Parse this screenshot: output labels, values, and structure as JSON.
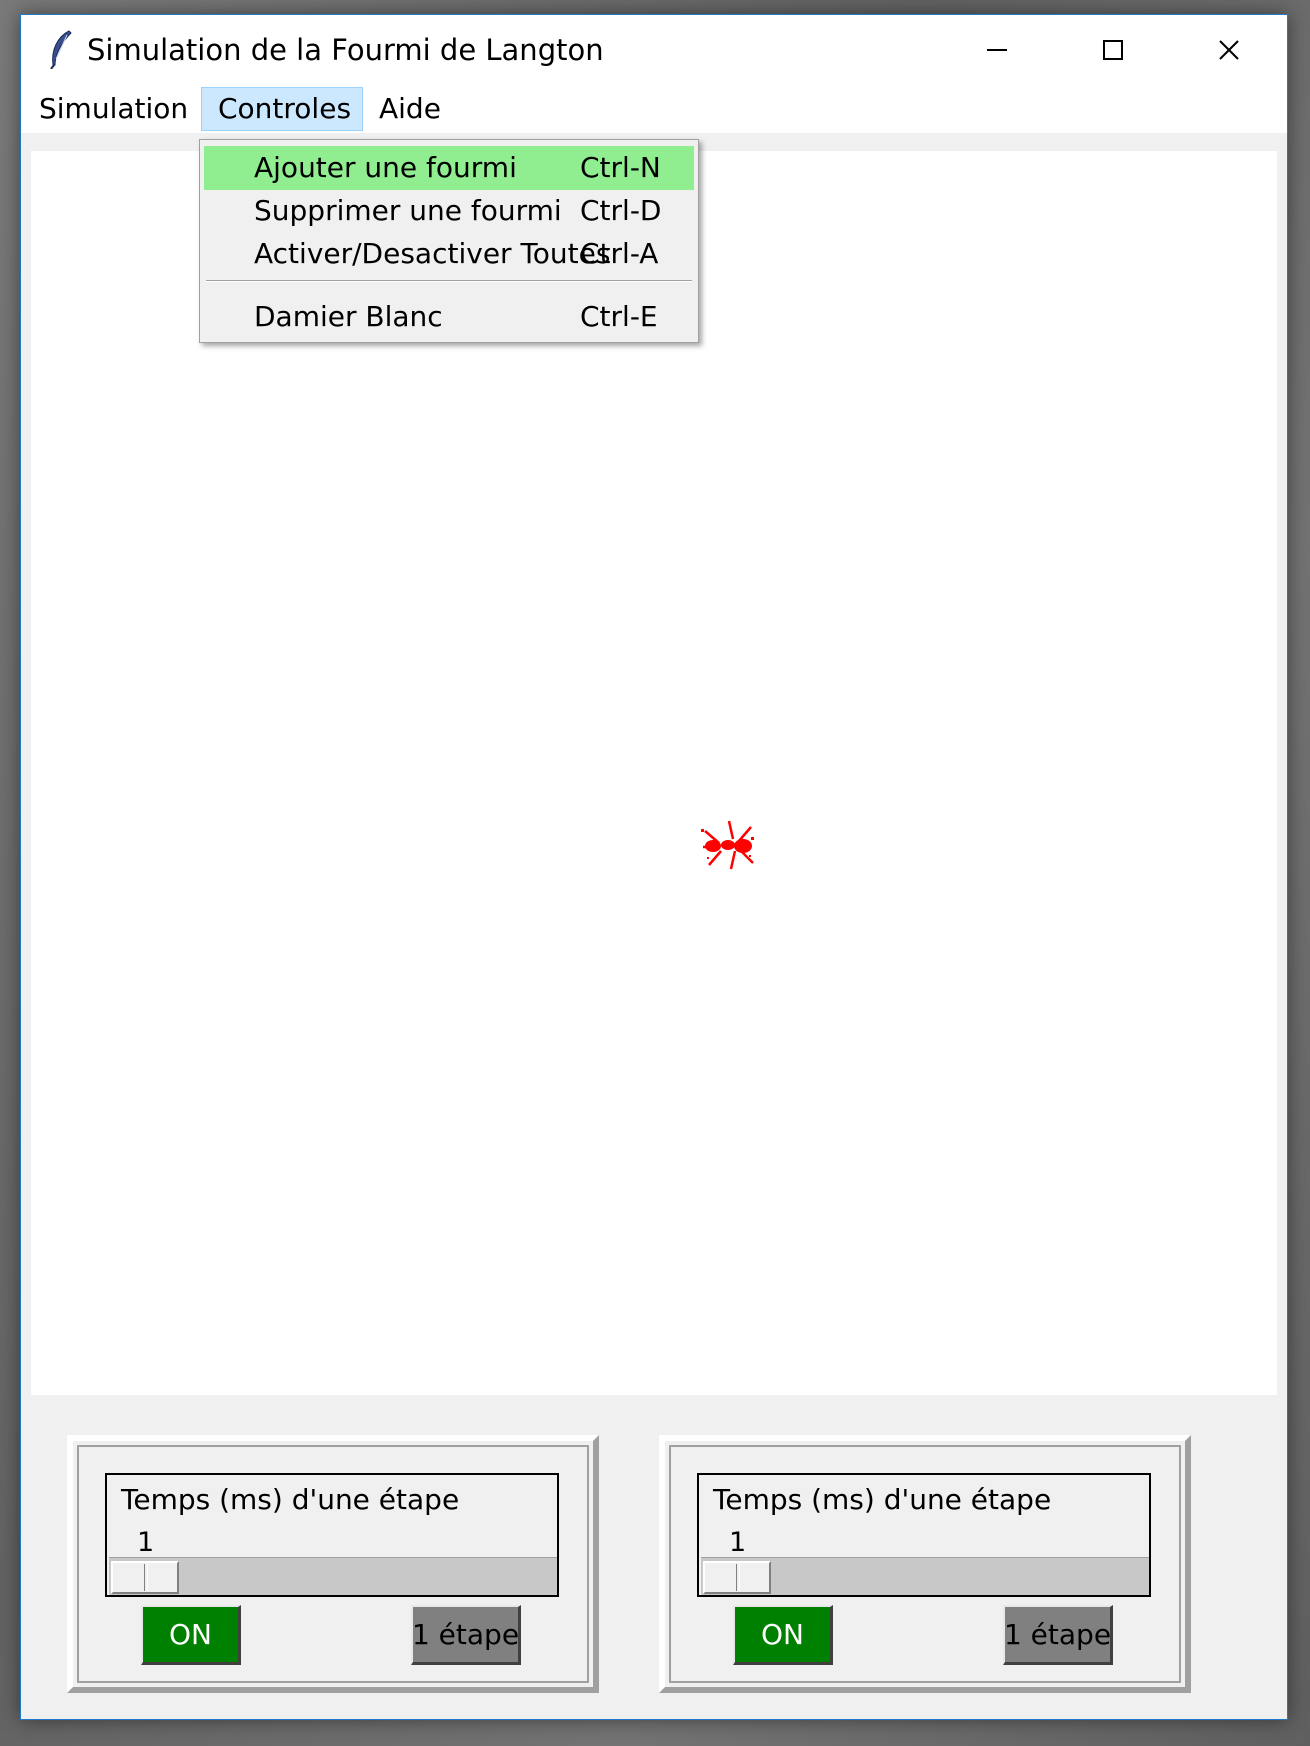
{
  "window": {
    "title": "Simulation de la Fourmi de Langton"
  },
  "menubar": {
    "items": [
      "Simulation",
      "Controles",
      "Aide"
    ],
    "open_menu": "Controles"
  },
  "dropdown": {
    "items": [
      {
        "label": "Ajouter une fourmi",
        "accel": "Ctrl-N",
        "highlighted": true
      },
      {
        "label": "Supprimer une fourmi",
        "accel": "Ctrl-D"
      },
      {
        "label": "Activer/Desactiver Toutes",
        "accel": "Ctrl-A"
      },
      {
        "label": "Damier Blanc",
        "accel": "Ctrl-E"
      }
    ],
    "highlight_color": "#90ee90"
  },
  "canvas": {
    "background": "#ffffff",
    "ant_color": "#ff0000",
    "ant_icon": "ant-icon"
  },
  "controls": [
    {
      "scale_label": "Temps (ms) d'une étape",
      "scale_value": "1",
      "on_label": "ON",
      "step_label": "1 étape"
    },
    {
      "scale_label": "Temps (ms) d'une étape",
      "scale_value": "1",
      "on_label": "ON",
      "step_label": "1 étape"
    }
  ],
  "colors": {
    "on_button": "#008000",
    "step_button": "#808080",
    "menu_active": "#cce8ff"
  }
}
